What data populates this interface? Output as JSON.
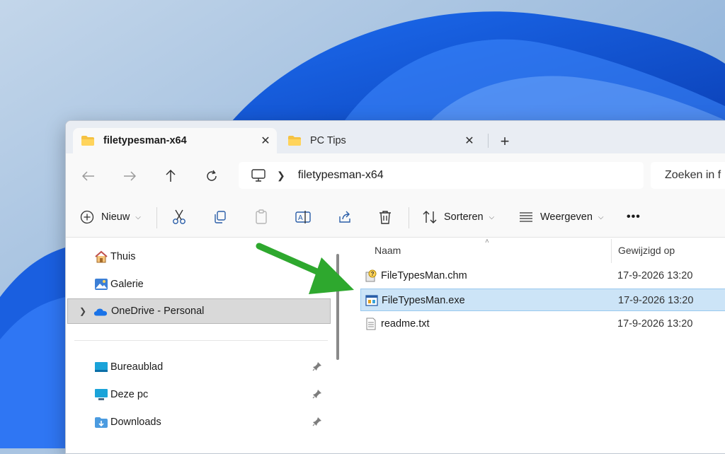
{
  "window": {
    "tabs": [
      {
        "label": "filetypesman-x64",
        "active": true
      },
      {
        "label": "PC Tips",
        "active": false
      }
    ],
    "new_tab": "+",
    "tab_close": "✕"
  },
  "navigation": {
    "breadcrumb": [
      "filetypesman-x64"
    ],
    "search_placeholder": "Zoeken in f"
  },
  "toolbar": {
    "new_label": "Nieuw",
    "sort_label": "Sorteren",
    "view_label": "Weergeven",
    "more_label": "•••"
  },
  "sidebar": {
    "items": [
      {
        "label": "Thuis",
        "icon": "home-icon"
      },
      {
        "label": "Galerie",
        "icon": "gallery-icon"
      },
      {
        "label": "OneDrive - Personal",
        "icon": "onedrive-cloud-icon",
        "selected": true
      },
      {
        "label": "Bureaublad",
        "icon": "desktop-icon",
        "pinned": true
      },
      {
        "label": "Deze pc",
        "icon": "computer-icon",
        "pinned": true
      },
      {
        "label": "Downloads",
        "icon": "downloads-icon",
        "pinned": true
      }
    ]
  },
  "file_list": {
    "columns": {
      "name": "Naam",
      "modified": "Gewijzigd op"
    },
    "rows": [
      {
        "name": "FileTypesMan.chm",
        "modified": "17-9-2026 13:20",
        "icon": "help-file-icon"
      },
      {
        "name": "FileTypesMan.exe",
        "modified": "17-9-2026 13:20",
        "icon": "application-icon",
        "selected": true
      },
      {
        "name": "readme.txt",
        "modified": "17-9-2026 13:20",
        "icon": "text-file-icon"
      }
    ]
  },
  "colors": {
    "accent": "#0067c0",
    "selection": "#cce4f7",
    "arrow": "#2ea82e",
    "folder": "#f5c242"
  }
}
